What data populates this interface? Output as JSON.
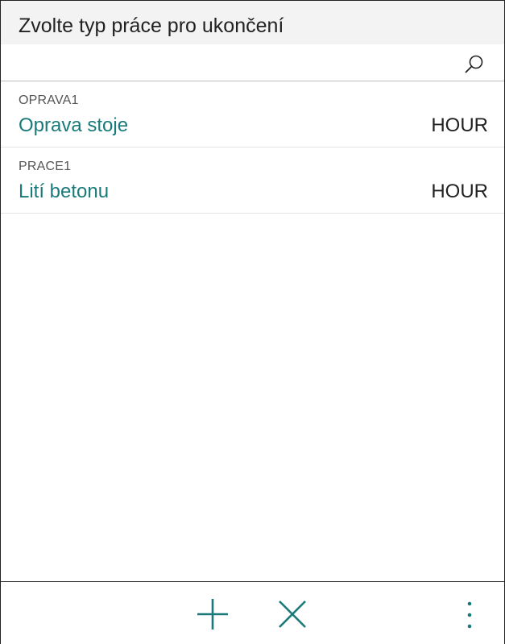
{
  "dialog": {
    "title": "Zvolte typ práce pro ukončení"
  },
  "search": {
    "icon": "search-icon"
  },
  "items": [
    {
      "code": "OPRAVA1",
      "name": "Oprava stoje",
      "unit": "HOUR"
    },
    {
      "code": "PRACE1",
      "name": "Lití betonu",
      "unit": "HOUR"
    }
  ],
  "toolbar": {
    "add_icon": "plus-icon",
    "cancel_icon": "close-icon",
    "more_icon": "more-vertical-icon"
  },
  "colors": {
    "accent": "#1a7a7a",
    "text": "#222222",
    "header_bg": "#f3f3f3"
  }
}
